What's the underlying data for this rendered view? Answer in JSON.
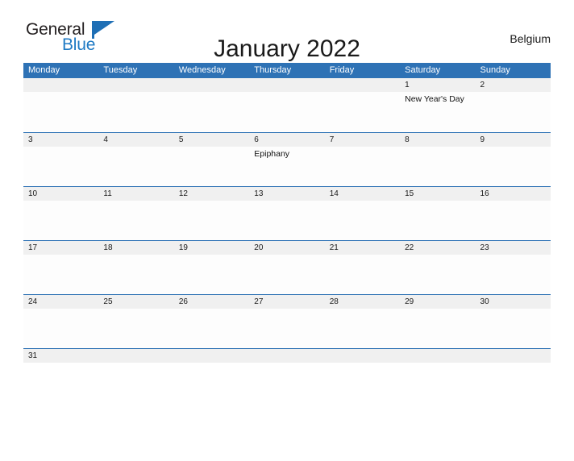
{
  "brand": {
    "name_part1": "General",
    "name_part2": "Blue",
    "flag_icon": "pennant-flag-icon"
  },
  "header": {
    "title": "January 2022",
    "country": "Belgium"
  },
  "calendar": {
    "month": "January",
    "year": "2022",
    "weekday_headers": [
      "Monday",
      "Tuesday",
      "Wednesday",
      "Thursday",
      "Friday",
      "Saturday",
      "Sunday"
    ],
    "accent_color": "#2e72b5",
    "daynum_band_color": "#f0f0f0",
    "weeks": [
      {
        "days": [
          {
            "num": "",
            "event": ""
          },
          {
            "num": "",
            "event": ""
          },
          {
            "num": "",
            "event": ""
          },
          {
            "num": "",
            "event": ""
          },
          {
            "num": "",
            "event": ""
          },
          {
            "num": "1",
            "event": "New Year's Day"
          },
          {
            "num": "2",
            "event": ""
          }
        ]
      },
      {
        "days": [
          {
            "num": "3",
            "event": ""
          },
          {
            "num": "4",
            "event": ""
          },
          {
            "num": "5",
            "event": ""
          },
          {
            "num": "6",
            "event": "Epiphany"
          },
          {
            "num": "7",
            "event": ""
          },
          {
            "num": "8",
            "event": ""
          },
          {
            "num": "9",
            "event": ""
          }
        ]
      },
      {
        "days": [
          {
            "num": "10",
            "event": ""
          },
          {
            "num": "11",
            "event": ""
          },
          {
            "num": "12",
            "event": ""
          },
          {
            "num": "13",
            "event": ""
          },
          {
            "num": "14",
            "event": ""
          },
          {
            "num": "15",
            "event": ""
          },
          {
            "num": "16",
            "event": ""
          }
        ]
      },
      {
        "days": [
          {
            "num": "17",
            "event": ""
          },
          {
            "num": "18",
            "event": ""
          },
          {
            "num": "19",
            "event": ""
          },
          {
            "num": "20",
            "event": ""
          },
          {
            "num": "21",
            "event": ""
          },
          {
            "num": "22",
            "event": ""
          },
          {
            "num": "23",
            "event": ""
          }
        ]
      },
      {
        "days": [
          {
            "num": "24",
            "event": ""
          },
          {
            "num": "25",
            "event": ""
          },
          {
            "num": "26",
            "event": ""
          },
          {
            "num": "27",
            "event": ""
          },
          {
            "num": "28",
            "event": ""
          },
          {
            "num": "29",
            "event": ""
          },
          {
            "num": "30",
            "event": ""
          }
        ]
      },
      {
        "partial": true,
        "days": [
          {
            "num": "31",
            "event": ""
          },
          {
            "num": "",
            "event": ""
          },
          {
            "num": "",
            "event": ""
          },
          {
            "num": "",
            "event": ""
          },
          {
            "num": "",
            "event": ""
          },
          {
            "num": "",
            "event": ""
          },
          {
            "num": "",
            "event": ""
          }
        ]
      }
    ]
  }
}
